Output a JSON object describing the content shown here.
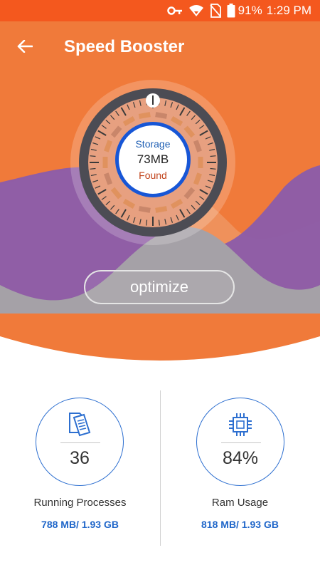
{
  "status_bar": {
    "icons": [
      "vpn-key-icon",
      "wifi-icon",
      "no-sim-icon",
      "battery-icon"
    ],
    "battery": "91%",
    "time": "1:29 PM"
  },
  "header": {
    "title": "Speed Booster"
  },
  "dial": {
    "label_top": "Storage",
    "value": "73MB",
    "label_bottom": "Found"
  },
  "actions": {
    "optimize_label": "optimize"
  },
  "stats": [
    {
      "icon": "documents-icon",
      "value": "36",
      "label": "Running Processes",
      "detail": "788 MB/ 1.93 GB"
    },
    {
      "icon": "cpu-chip-icon",
      "value": "84%",
      "label": "Ram Usage",
      "detail": "818 MB/ 1.93 GB"
    }
  ],
  "colors": {
    "status_bar": "#f4581e",
    "hero_orange": "#f07a3a",
    "accent_blue": "#1f66c9",
    "found_red": "#c1431b"
  }
}
